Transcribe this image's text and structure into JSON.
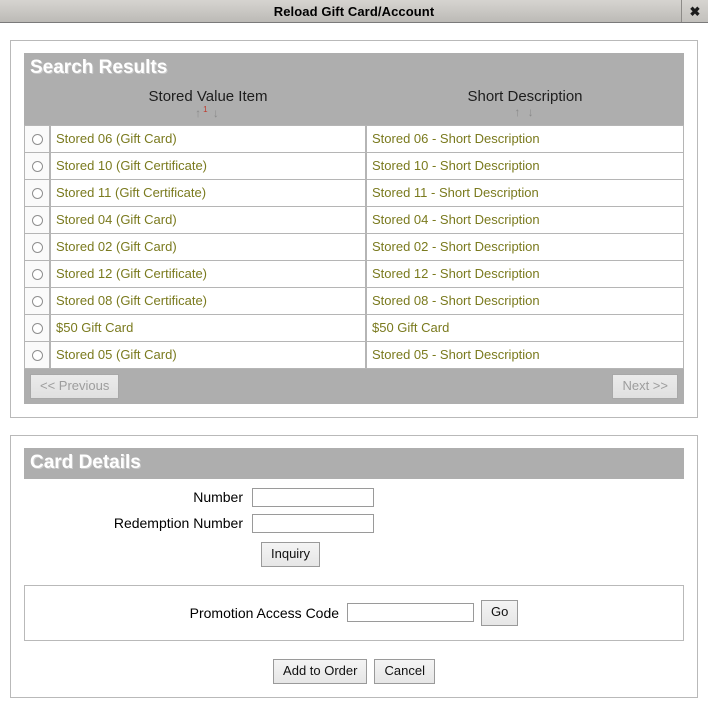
{
  "window": {
    "title": "Reload Gift Card/Account",
    "close_label": "✖"
  },
  "search_results": {
    "heading": "Search Results",
    "columns": {
      "item": "Stored Value Item",
      "description": "Short Description"
    },
    "sort": {
      "asc_arrow": "↑",
      "desc_arrow": "↓",
      "active_index_label": "1"
    },
    "rows": [
      {
        "item": "Stored 06 (Gift Card)",
        "description": "Stored 06 - Short Description"
      },
      {
        "item": "Stored 10 (Gift Certificate)",
        "description": "Stored 10 - Short Description"
      },
      {
        "item": "Stored 11 (Gift Certificate)",
        "description": "Stored 11 - Short Description"
      },
      {
        "item": "Stored 04 (Gift Card)",
        "description": "Stored 04 - Short Description"
      },
      {
        "item": "Stored 02 (Gift Card)",
        "description": "Stored 02 - Short Description"
      },
      {
        "item": "Stored 12 (Gift Certificate)",
        "description": "Stored 12 - Short Description"
      },
      {
        "item": "Stored 08 (Gift Certificate)",
        "description": "Stored 08 - Short Description"
      },
      {
        "item": "$50 Gift Card",
        "description": "$50 Gift Card"
      },
      {
        "item": "Stored 05 (Gift Card)",
        "description": "Stored 05 - Short Description"
      }
    ],
    "pager": {
      "previous_label": "<< Previous",
      "next_label": "Next >>"
    }
  },
  "card_details": {
    "heading": "Card Details",
    "number_label": "Number",
    "number_value": "",
    "redemption_label": "Redemption Number",
    "redemption_value": "",
    "inquiry_label": "Inquiry",
    "promotion_label": "Promotion Access Code",
    "promotion_value": "",
    "go_label": "Go",
    "add_to_order_label": "Add to Order",
    "cancel_label": "Cancel"
  },
  "colors": {
    "header_band": "#aeaeae",
    "link_text": "#7a7a1e",
    "sort_active": "#c0392b",
    "panel_border": "#b9b9b9"
  }
}
